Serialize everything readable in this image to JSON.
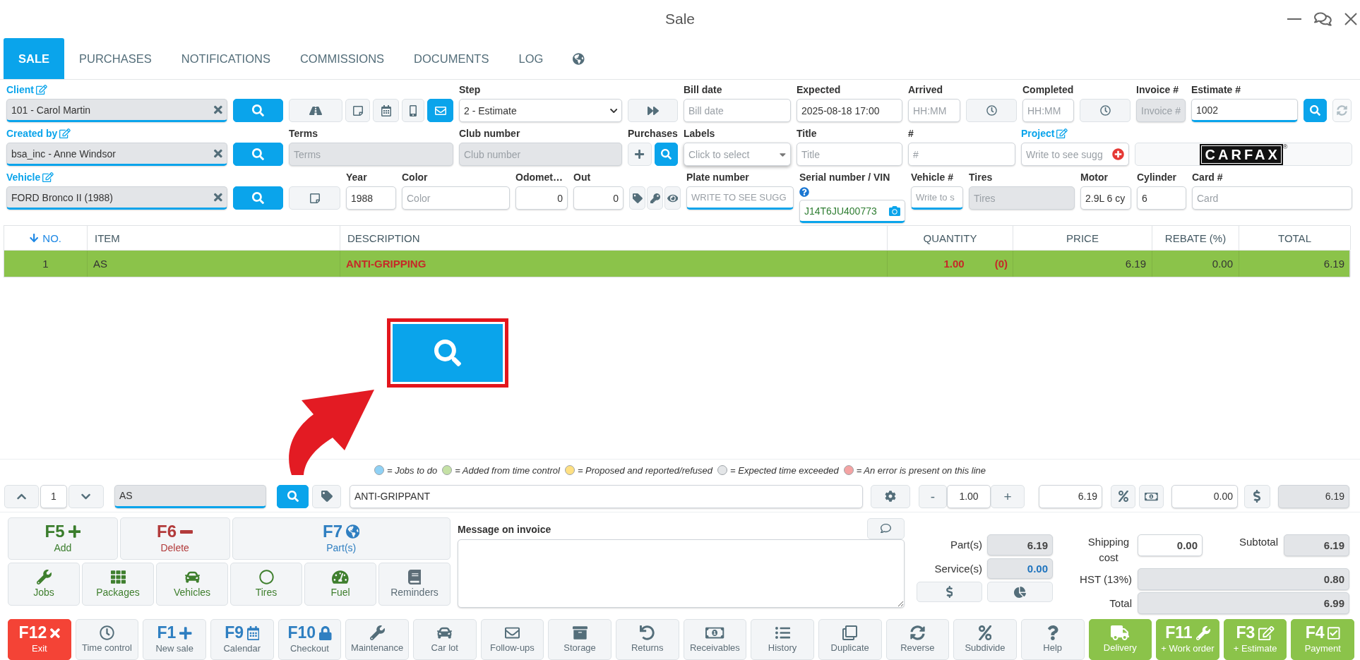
{
  "window": {
    "title": "Sale"
  },
  "tabs": [
    {
      "kind": "text",
      "label": "SALE",
      "selected": true
    },
    {
      "kind": "text",
      "label": "PURCHASES",
      "selected": false
    },
    {
      "kind": "text",
      "label": "NOTIFICATIONS",
      "selected": false
    },
    {
      "kind": "text",
      "label": "COMMISSIONS",
      "selected": false
    },
    {
      "kind": "text",
      "label": "DOCUMENTS",
      "selected": false
    },
    {
      "kind": "text",
      "label": "LOG",
      "selected": false
    },
    {
      "kind": "language",
      "selected": false
    }
  ],
  "form_rows": [
    [
      {
        "kind": "entity",
        "label": "Client",
        "value": "101 - Carol Martin"
      },
      {
        "kind": "search"
      },
      {
        "kind": "contact",
        "buttons": [
          {
            "on": false
          },
          {
            "on": false
          },
          {
            "on": false
          },
          {
            "on": false
          },
          {
            "on": true
          }
        ]
      },
      {
        "kind": "select",
        "label": "Step",
        "value": "2 - Estimate"
      },
      {
        "kind": "forward"
      },
      {
        "kind": "input",
        "label": "Bill date",
        "placeholder": "Bill date",
        "disabled": false,
        "lookup": false
      },
      {
        "kind": "input",
        "label": "Expected",
        "value": "2025-08-18 17:00",
        "disabled": false,
        "lookup": false
      },
      {
        "kind": "input",
        "label": "Arrived",
        "placeholder": "HH:MM",
        "disabled": false,
        "lookup": false
      },
      {
        "kind": "clock"
      },
      {
        "kind": "input",
        "label": "Completed",
        "placeholder": "HH:MM",
        "disabled": false,
        "lookup": false
      },
      {
        "kind": "clock"
      },
      {
        "kind": "input",
        "label": "Invoice #",
        "placeholder": "Invoice #",
        "disabled": true,
        "lookup": false
      },
      {
        "kind": "input",
        "label": "Estimate #",
        "value": "1002",
        "disabled": false,
        "lookup": true
      },
      {
        "kind": "search"
      },
      {
        "kind": "refresh"
      }
    ],
    [
      {
        "kind": "entity",
        "label": "Created by",
        "value": "bsa_inc - Anne Windsor"
      },
      {
        "kind": "search"
      },
      {
        "kind": "input",
        "label": "Terms",
        "placeholder": "Terms",
        "disabled": true,
        "lookup": false
      },
      {
        "kind": "input",
        "label": "Club number",
        "placeholder": "Club number",
        "disabled": true,
        "lookup": false
      },
      {
        "kind": "purchases",
        "label": "Purchases"
      },
      {
        "kind": "multiselect",
        "label": "Labels",
        "placeholder": "Click to select"
      },
      {
        "kind": "input",
        "label": "Title",
        "placeholder": "Title",
        "disabled": false,
        "lookup": false
      },
      {
        "kind": "input",
        "label": "#",
        "placeholder": "#",
        "disabled": false,
        "lookup": false
      },
      {
        "kind": "project",
        "label": "Project",
        "placeholder": "Write to see sugg"
      },
      {
        "kind": "carfax",
        "logo": "CARFAX",
        "mark": "®"
      }
    ],
    [
      {
        "kind": "entity",
        "label": "Vehicle",
        "value": "FORD Bronco II (1988)"
      },
      {
        "kind": "search"
      },
      {
        "kind": "note"
      },
      {
        "kind": "input",
        "label": "Year",
        "value": "1988",
        "disabled": false,
        "lookup": false
      },
      {
        "kind": "input",
        "label": "Color",
        "placeholder": "Color",
        "disabled": false,
        "lookup": false
      },
      {
        "kind": "input",
        "label": "Odomet…",
        "value": "0",
        "disabled": false,
        "lookup": false
      },
      {
        "kind": "input",
        "label": "Out",
        "value": "0",
        "disabled": false,
        "lookup": false
      },
      {
        "kind": "vehicle_tools"
      },
      {
        "kind": "input",
        "label": "Plate number",
        "placeholder": "WRITE TO SEE SUGG",
        "disabled": false,
        "lookup": true
      },
      {
        "kind": "vin",
        "label": "Serial number / VIN",
        "value": "J14T6JU400773"
      },
      {
        "kind": "input",
        "label": "Vehicle #",
        "placeholder": "Write to s",
        "disabled": false,
        "lookup": true
      },
      {
        "kind": "input",
        "label": "Tires",
        "placeholder": "Tires",
        "disabled": true,
        "lookup": false
      },
      {
        "kind": "input",
        "label": "Motor",
        "value": "2.9L 6 cy",
        "disabled": false,
        "lookup": false
      },
      {
        "kind": "input",
        "label": "Cylinder",
        "value": "6",
        "disabled": false,
        "lookup": false
      },
      {
        "kind": "input",
        "label": "Card #",
        "placeholder": "Card",
        "disabled": false,
        "lookup": false
      }
    ]
  ],
  "table": {
    "columns": [
      {
        "label": "NO.",
        "sorted": true
      },
      {
        "label": "ITEM",
        "sorted": false
      },
      {
        "label": "DESCRIPTION",
        "sorted": false
      },
      {
        "label": "QUANTITY",
        "sorted": false
      },
      {
        "label": "PRICE",
        "sorted": false
      },
      {
        "label": "REBATE (%)",
        "sorted": false
      },
      {
        "label": "TOTAL",
        "sorted": false
      }
    ],
    "rows": [
      {
        "selected": true,
        "no": "1",
        "item": "AS",
        "description": "ANTI-GRIPPING",
        "quantity": "1.00",
        "reserved": "(0)",
        "price": "6.19",
        "rebate": "0.00",
        "total": "6.19"
      }
    ]
  },
  "legend": [
    {
      "color": "#8fd1f5",
      "label": "= Jobs to do"
    },
    {
      "color": "#c5e1a5",
      "label": "= Added from time control"
    },
    {
      "color": "#ffe082",
      "label": "= Proposed and reported/refused"
    },
    {
      "color": "#e4e6e8",
      "label": "= Expected time exceeded"
    },
    {
      "color": "#f4a3a3",
      "label": "= An error is present on this line"
    }
  ],
  "line_editor": {
    "line": "1",
    "item_code": "AS",
    "description": "ANTI-GRIPPANT",
    "minus": "-",
    "quantity": "1.00",
    "plus": "+",
    "price": "6.19",
    "rebate": "0.00",
    "total": "6.19"
  },
  "actions": [
    {
      "kind": "add",
      "key": "F5",
      "label": "Add"
    },
    {
      "kind": "delete",
      "key": "F6",
      "label": "Delete"
    },
    {
      "kind": "parts",
      "key": "F7",
      "label": "Part(s)"
    }
  ],
  "categories": [
    {
      "kind": "jobs",
      "label": "Jobs"
    },
    {
      "kind": "packages",
      "label": "Packages"
    },
    {
      "kind": "vehicles",
      "label": "Vehicles"
    },
    {
      "kind": "tires",
      "label": "Tires"
    },
    {
      "kind": "fuel",
      "label": "Fuel"
    },
    {
      "kind": "reminders",
      "label": "Reminders"
    }
  ],
  "message": {
    "label": "Message on invoice"
  },
  "totals": {
    "parts": {
      "label": "Part(s)",
      "value": "6.19"
    },
    "services": {
      "label": "Service(s)",
      "value": "0.00"
    },
    "shipping": {
      "label": "Shipping cost",
      "value": "0.00"
    },
    "subtotal": {
      "label": "Subtotal",
      "value": "6.19"
    },
    "tax": {
      "label": "HST (13%)",
      "value": "0.80"
    },
    "total": {
      "label": "Total",
      "value": "6.99"
    }
  },
  "footer": [
    {
      "kind": "exit",
      "key": "F12",
      "label": "Exit"
    },
    {
      "kind": "time",
      "label": "Time control"
    },
    {
      "kind": "new",
      "key": "F1",
      "label": "New sale"
    },
    {
      "kind": "calendar",
      "key": "F9",
      "label": "Calendar"
    },
    {
      "kind": "checkout",
      "key": "F10",
      "label": "Checkout"
    },
    {
      "kind": "maintenance",
      "label": "Maintenance"
    },
    {
      "kind": "car_lot",
      "label": "Car lot"
    },
    {
      "kind": "follow_ups",
      "label": "Follow-ups"
    },
    {
      "kind": "storage",
      "label": "Storage"
    },
    {
      "kind": "returns",
      "label": "Returns"
    },
    {
      "kind": "receivables",
      "label": "Receivables"
    },
    {
      "kind": "history",
      "label": "History"
    },
    {
      "kind": "duplicate",
      "label": "Duplicate"
    },
    {
      "kind": "reverse",
      "label": "Reverse"
    },
    {
      "kind": "subdivide",
      "label": "Subdivide"
    },
    {
      "kind": "help",
      "label": "Help"
    },
    {
      "kind": "delivery",
      "label": "Delivery"
    },
    {
      "kind": "work_order",
      "key": "F11",
      "label": "+ Work order"
    },
    {
      "kind": "estimate",
      "key": "F3",
      "label": "+ Estimate"
    },
    {
      "kind": "payment",
      "key": "F4",
      "label": "Payment"
    }
  ]
}
